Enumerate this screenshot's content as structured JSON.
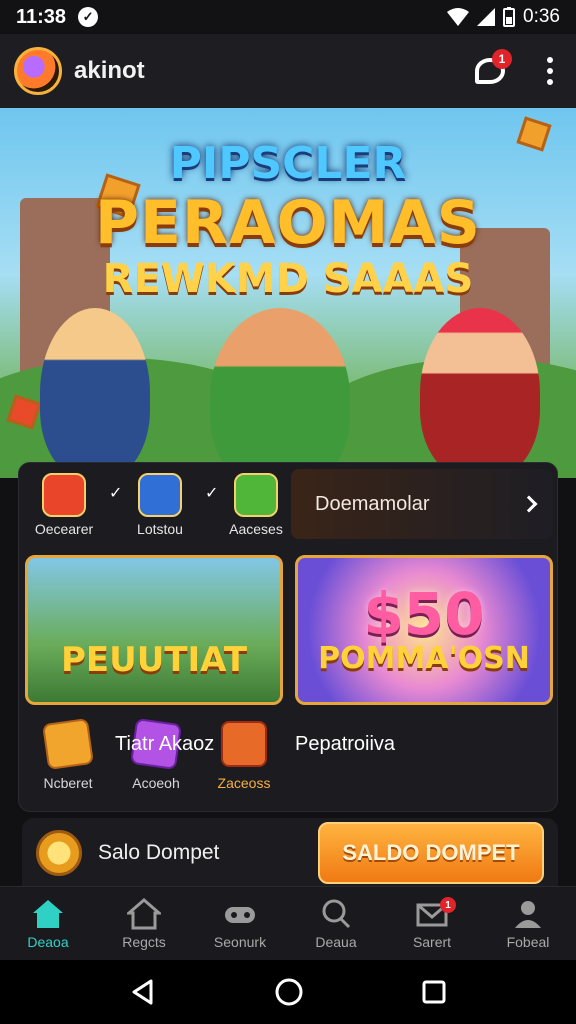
{
  "status_bar": {
    "time": "11:38",
    "notif_glyph": "✓",
    "battery_time": "0:36"
  },
  "app_bar": {
    "title": "akinot",
    "chat_badge": "1",
    "logo_icon": "app-logo-icon",
    "chat_icon": "chat-icon",
    "menu_icon": "more-vert-icon"
  },
  "hero": {
    "line1": "PIPSCLER",
    "line2": "PERAOMAS",
    "line3": "REWKMD SAAAS"
  },
  "categories": {
    "items": [
      {
        "label": "Oecearer",
        "icon": "monster-icon",
        "color": "#e8452a"
      },
      {
        "label": "Lotstou",
        "icon": "bag-icon",
        "color": "#2f6fd6"
      },
      {
        "label": "Aaceses",
        "icon": "swirl-icon",
        "color": "#4fb63a"
      }
    ],
    "checks": [
      "✓",
      "✓"
    ],
    "promo_label": "Doemamolar"
  },
  "cards": [
    {
      "text": "PEUUTIAT"
    },
    {
      "big": "$50",
      "text": "POMMA'OSN"
    }
  ],
  "promos": {
    "items": [
      {
        "label": "Ncberet"
      },
      {
        "label": "Acoeoh"
      },
      {
        "label": "Zaceoss"
      }
    ],
    "head1": "Tiatr Akaoz",
    "head2": "Pepatroiiva"
  },
  "wallet": {
    "label": "Salo Dompet",
    "button": "SALDO DOMPET"
  },
  "bottom_nav": [
    {
      "label": "Deaoa",
      "icon": "home-icon"
    },
    {
      "label": "Regcts",
      "icon": "house-icon"
    },
    {
      "label": "Seonurk",
      "icon": "gamepad-icon"
    },
    {
      "label": "Deaua",
      "icon": "search-icon"
    },
    {
      "label": "Sarert",
      "icon": "mail-icon",
      "badge": "1"
    },
    {
      "label": "Fobeal",
      "icon": "profile-icon"
    }
  ]
}
